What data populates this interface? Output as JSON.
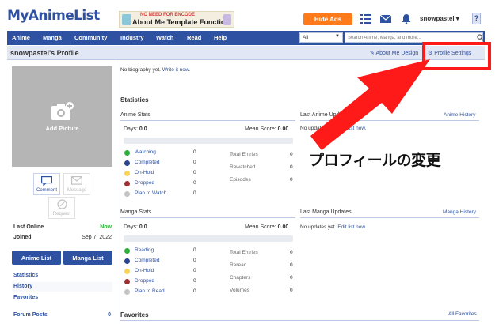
{
  "header": {
    "logo": "MyAnimeList",
    "banner_top": "NO NEED FOR ENCODE",
    "banner_main": "About Me Template Function",
    "hide_ads": "Hide Ads",
    "username": "snowpastel ▾",
    "help": "?"
  },
  "nav": {
    "items": [
      "Anime",
      "Manga",
      "Community",
      "Industry",
      "Watch",
      "Read",
      "Help"
    ],
    "search_category": "All",
    "search_placeholder": "Search Anime, Manga, and more..."
  },
  "titlebar": {
    "title": "snowpastel's Profile",
    "about_me_design": "About Me Design",
    "profile_settings": "Profile Settings"
  },
  "left": {
    "add_picture": "Add Picture",
    "comment": "Comment",
    "message": "Message",
    "request": "Request",
    "last_online_label": "Last Online",
    "last_online_value": "Now",
    "joined_label": "Joined",
    "joined_value": "Sep 7, 2022",
    "anime_list": "Anime List",
    "manga_list": "Manga List",
    "statistics": "Statistics",
    "history": "History",
    "favorites": "Favorites",
    "forum_posts_label": "Forum Posts",
    "forum_posts_value": "0"
  },
  "main": {
    "bio_text": "No biography yet.",
    "bio_link": "Write it now.",
    "statistics_title": "Statistics",
    "anime_stats": {
      "heading": "Anime Stats",
      "days_label": "Days:",
      "days": "0.0",
      "mean_label": "Mean Score:",
      "mean": "0.00",
      "statuses": [
        {
          "label": "Watching",
          "count": "0",
          "color": "#2db039"
        },
        {
          "label": "Completed",
          "count": "0",
          "color": "#26448f"
        },
        {
          "label": "On-Hold",
          "count": "0",
          "color": "#f9d457"
        },
        {
          "label": "Dropped",
          "count": "0",
          "color": "#a12f31"
        },
        {
          "label": "Plan to Watch",
          "count": "0",
          "color": "#c3c3c3"
        }
      ],
      "entries": [
        {
          "label": "Total Entries",
          "count": "0"
        },
        {
          "label": "Rewatched",
          "count": "0"
        },
        {
          "label": "Episodes",
          "count": "0"
        }
      ]
    },
    "manga_stats": {
      "heading": "Manga Stats",
      "days_label": "Days:",
      "days": "0.0",
      "mean_label": "Mean Score:",
      "mean": "0.00",
      "statuses": [
        {
          "label": "Reading",
          "count": "0",
          "color": "#2db039"
        },
        {
          "label": "Completed",
          "count": "0",
          "color": "#26448f"
        },
        {
          "label": "On-Hold",
          "count": "0",
          "color": "#f9d457"
        },
        {
          "label": "Dropped",
          "count": "0",
          "color": "#a12f31"
        },
        {
          "label": "Plan to Read",
          "count": "0",
          "color": "#c3c3c3"
        }
      ],
      "entries": [
        {
          "label": "Total Entries",
          "count": "0"
        },
        {
          "label": "Reread",
          "count": "0"
        },
        {
          "label": "Chapters",
          "count": "0"
        },
        {
          "label": "Volumes",
          "count": "0"
        }
      ]
    },
    "last_anime": {
      "heading": "Last Anime Updates",
      "link": "Anime History",
      "text": "No updates yet.",
      "action": "Edit list now."
    },
    "last_manga": {
      "heading": "Last Manga Updates",
      "link": "Manga History",
      "text": "No updates yet.",
      "action": "Edit list now."
    },
    "favorites": {
      "heading": "Favorites",
      "link": "All Favorites"
    }
  },
  "annotation": {
    "text": "プロフィールの変更",
    "color": "#ff1a1a"
  }
}
